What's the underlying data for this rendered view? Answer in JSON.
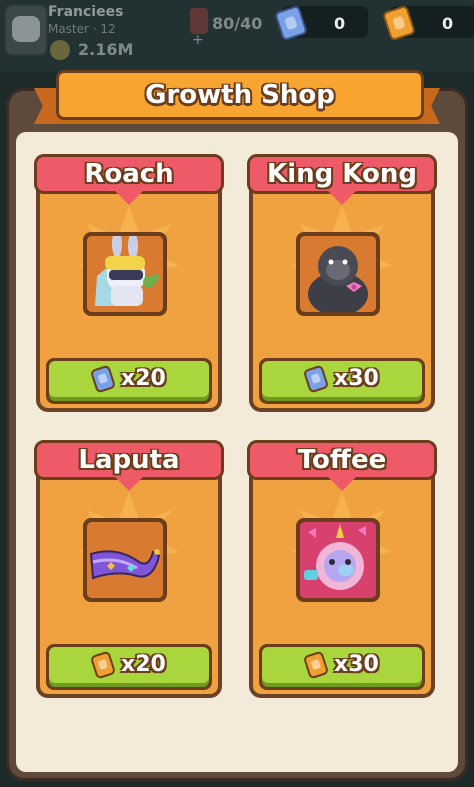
{
  "player": {
    "name": "Franciees",
    "rank": "Master · 12",
    "coins": "2.16M",
    "energy": "80/40"
  },
  "resources": [
    {
      "icon": "blue-ticket-icon",
      "value": "0",
      "color": "#7aa0e8"
    },
    {
      "icon": "gold-ticket-icon",
      "value": "0",
      "color": "#f0a030"
    }
  ],
  "shop": {
    "title": "Growth Shop",
    "items": [
      {
        "name": "Roach",
        "price": "x20",
        "currency": "blue-ticket-icon",
        "ticket_color": "#7aa0e8"
      },
      {
        "name": "King Kong",
        "price": "x30",
        "currency": "blue-ticket-icon",
        "ticket_color": "#7aa0e8"
      },
      {
        "name": "Laputa",
        "price": "x20",
        "currency": "gold-ticket-icon",
        "ticket_color": "#f0a030"
      },
      {
        "name": "Toffee",
        "price": "x30",
        "currency": "gold-ticket-icon",
        "ticket_color": "#f0a030"
      }
    ]
  },
  "colors": {
    "panel": "#5e4a3c",
    "card_header": "#ef5a68",
    "card_body": "#f0a240",
    "buy_button": "#a8d63c",
    "outline": "#6b3d1c"
  }
}
